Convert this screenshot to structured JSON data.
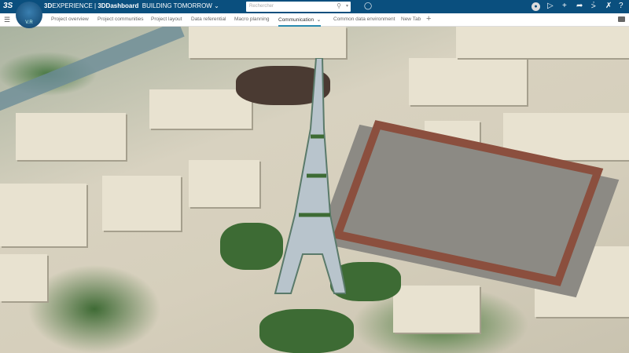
{
  "topbar": {
    "brand_bold": "3D",
    "brand": "EXPERIENCE | ",
    "app": "3DDashboard",
    "dashboard": "BUILDING TOMORROW",
    "compass_version": "V.R",
    "search_placeholder": "Rechercher"
  },
  "tabs": [
    {
      "label": "Project overview"
    },
    {
      "label": "Project communities"
    },
    {
      "label": "Project layout"
    },
    {
      "label": "Data referential"
    },
    {
      "label": "Macro planning"
    },
    {
      "label": "Communication",
      "active": true
    },
    {
      "label": "Common data environment"
    },
    {
      "label": "New Tab"
    }
  ],
  "colors": {
    "topbar": "#0a4f7e",
    "active_tab": "#2a8bb0"
  }
}
